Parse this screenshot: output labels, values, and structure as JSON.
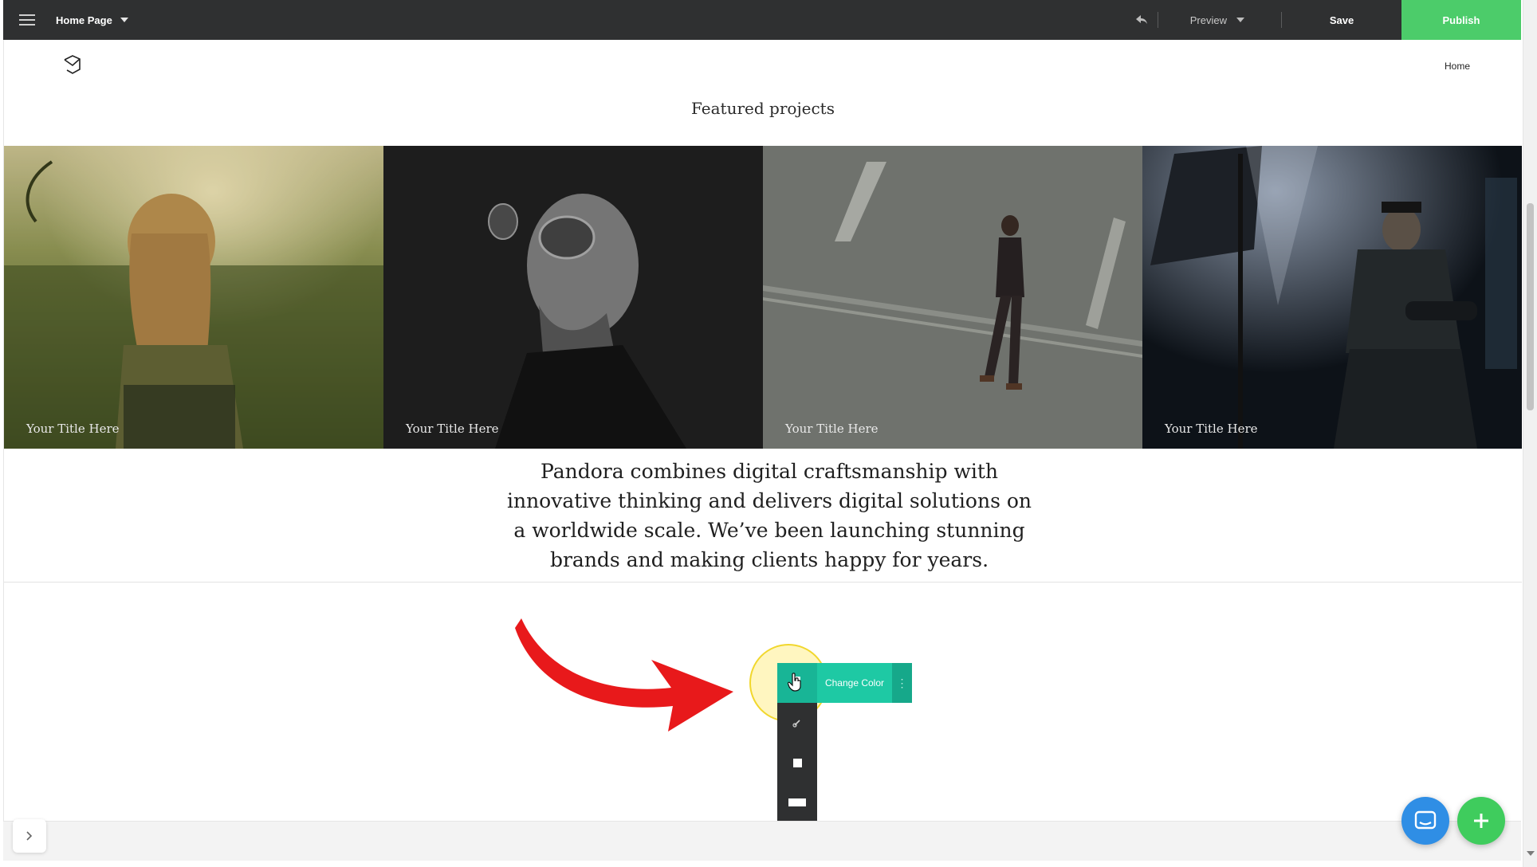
{
  "toolbar": {
    "page_name": "Home Page",
    "preview_label": "Preview",
    "save_label": "Save",
    "publish_label": "Publish"
  },
  "site": {
    "nav_home": "Home",
    "featured_title": "Featured projects",
    "projects": [
      {
        "title": "Your Title Here"
      },
      {
        "title": "Your Title Here"
      },
      {
        "title": "Your Title Here"
      },
      {
        "title": "Your Title Here"
      }
    ],
    "about_text": "Pandora combines digital craftsmanship with innovative thinking and delivers digital solutions on a worldwide scale. We’ve been launching stunning brands and making clients happy for years."
  },
  "element_toolbar": {
    "change_color_label": "Change Color",
    "more_label": "⋮"
  },
  "colors": {
    "topbar_bg": "#2f3031",
    "publish_green": "#4ccc6a",
    "tool_teal": "#1ec9a4",
    "chat_blue": "#2f8ee5",
    "add_green": "#3fcc5d",
    "arrow_red": "#e8191b"
  }
}
